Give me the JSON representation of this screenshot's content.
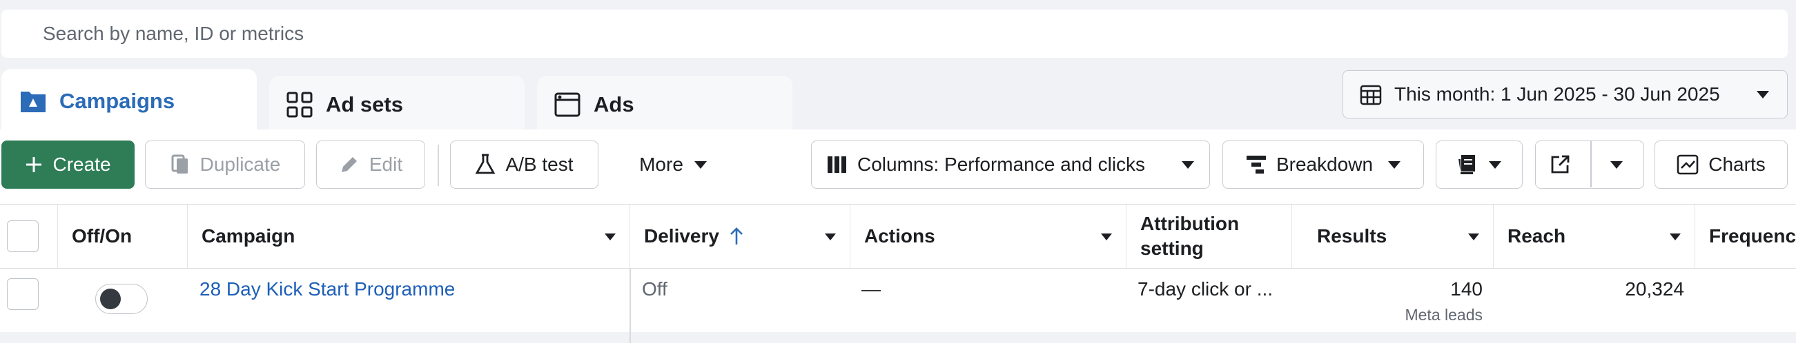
{
  "search": {
    "placeholder": "Search by name, ID or metrics"
  },
  "tabs": [
    {
      "label": "Campaigns",
      "icon": "campaign-folder-icon",
      "active": true
    },
    {
      "label": "Ad sets",
      "icon": "ad-sets-grid-icon",
      "active": false
    },
    {
      "label": "Ads",
      "icon": "ad-window-icon",
      "active": false
    }
  ],
  "date_range": {
    "label": "This month: 1 Jun 2025 - 30 Jun 2025",
    "icon": "calendar-icon"
  },
  "toolbar": {
    "create_label": "Create",
    "duplicate_label": "Duplicate",
    "edit_label": "Edit",
    "ab_test_label": "A/B test",
    "more_label": "More",
    "columns_label": "Columns: Performance and clicks",
    "breakdown_label": "Breakdown",
    "charts_label": "Charts"
  },
  "table": {
    "headers": {
      "off_on": "Off/On",
      "campaign": "Campaign",
      "delivery": "Delivery",
      "actions": "Actions",
      "attribution": "Attribution setting",
      "results": "Results",
      "reach": "Reach",
      "frequency": "Frequenc"
    },
    "rows": [
      {
        "campaign": "28 Day Kick Start Programme",
        "delivery": "Off",
        "actions": "—",
        "attribution": "7-day click or ...",
        "results": "140",
        "results_sub": "Meta leads",
        "reach": "20,324"
      }
    ]
  },
  "colors": {
    "accent": "#2b6bb8",
    "create": "#2e7d57",
    "link": "#1e5fb8"
  }
}
